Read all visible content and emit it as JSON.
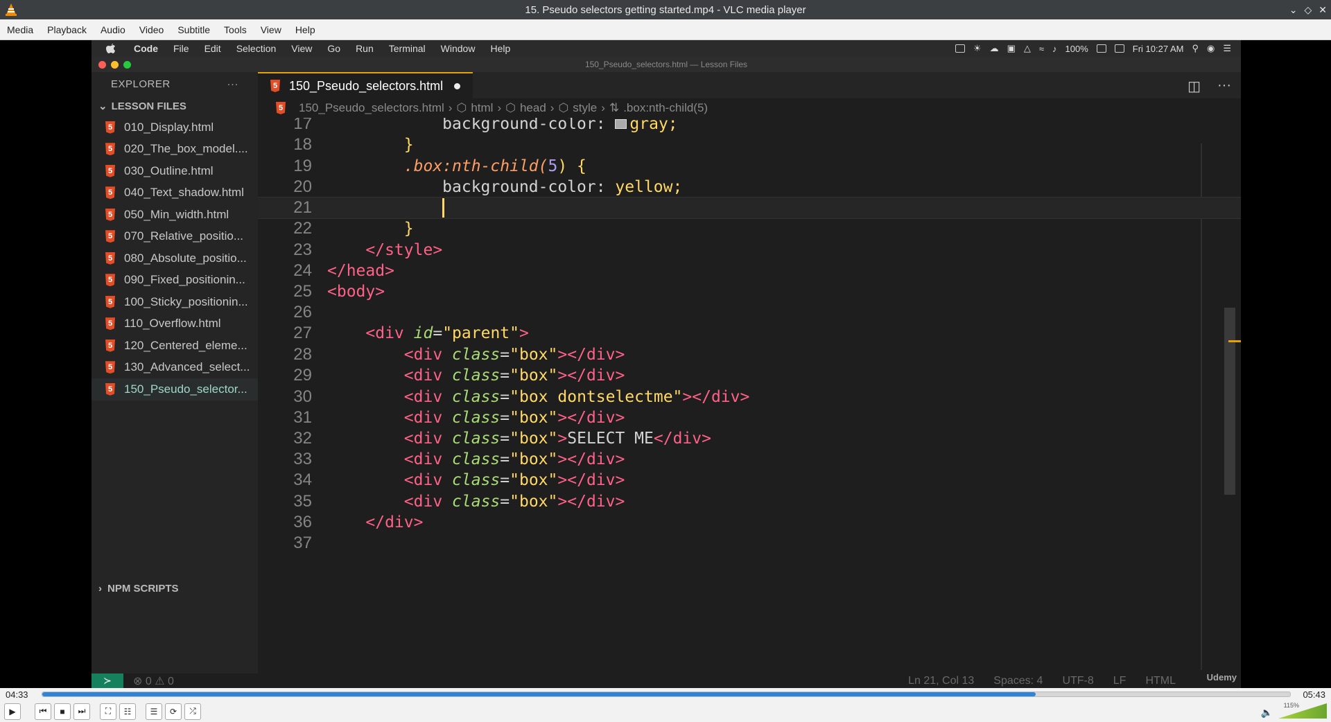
{
  "vlc": {
    "title": "15. Pseudo selectors getting started.mp4 - VLC media player",
    "menu": [
      "Media",
      "Playback",
      "Audio",
      "Video",
      "Subtitle",
      "Tools",
      "View",
      "Help"
    ],
    "time_elapsed": "04:33",
    "time_total": "05:43",
    "progress": 0.796,
    "volume_label": "115%",
    "volume_level": 1.15
  },
  "mac": {
    "menu": [
      "Code",
      "File",
      "Edit",
      "Selection",
      "View",
      "Go",
      "Run",
      "Terminal",
      "Window",
      "Help"
    ],
    "battery": "100%",
    "clock": "Fri 10:27 AM"
  },
  "vscode": {
    "window_title": "150_Pseudo_selectors.html — Lesson Files",
    "explorer_header": "EXPLORER",
    "section": "LESSON FILES",
    "files": [
      "010_Display.html",
      "020_The_box_model....",
      "030_Outline.html",
      "040_Text_shadow.html",
      "050_Min_width.html",
      "070_Relative_positio...",
      "080_Absolute_positio...",
      "090_Fixed_positionin...",
      "100_Sticky_positionin...",
      "110_Overflow.html",
      "120_Centered_eleme...",
      "130_Advanced_select...",
      "150_Pseudo_selector..."
    ],
    "npm": "NPM SCRIPTS",
    "tab": "150_Pseudo_selectors.html",
    "breadcrumb": [
      "150_Pseudo_selectors.html",
      "html",
      "head",
      "style",
      ".box:nth-child(5)"
    ],
    "status": {
      "problems": "⊗ 0 ⚠ 0",
      "position": "Ln 21, Col 13",
      "spaces": "Spaces: 4",
      "encoding": "UTF-8",
      "eol": "LF",
      "lang": "HTML"
    },
    "watermark": "Udemy",
    "line_numbers": [
      "17",
      "18",
      "19",
      "20",
      "21",
      "22",
      "23",
      "24",
      "25",
      "26",
      "27",
      "28",
      "29",
      "30",
      "31",
      "32",
      "33",
      "34",
      "35",
      "36",
      "37"
    ],
    "code": {
      "l17_prop": "background-color: ",
      "l17_val": "gray;",
      "l18": "}",
      "l19_sel": ".box:nth-child(",
      "l19_num": "5",
      "l19_close": ") {",
      "l20_prop": "background-color: ",
      "l20_val": "yellow;",
      "l22": "}",
      "l23": "</style>",
      "l24": "</head>",
      "l25": "<body>",
      "l27_open": "<div ",
      "l27_attr": "id",
      "l27_eq": "=",
      "l27_str": "\"parent\"",
      "l27_close": ">",
      "div_open": "<div ",
      "class_attr": "class",
      "eq": "=",
      "box_str": "\"box\"",
      "box_dont": "\"box dontselectme\"",
      "gt": ">",
      "div_close": "</div>",
      "select_me": "SELECT ME",
      "l36": "</div>"
    }
  }
}
